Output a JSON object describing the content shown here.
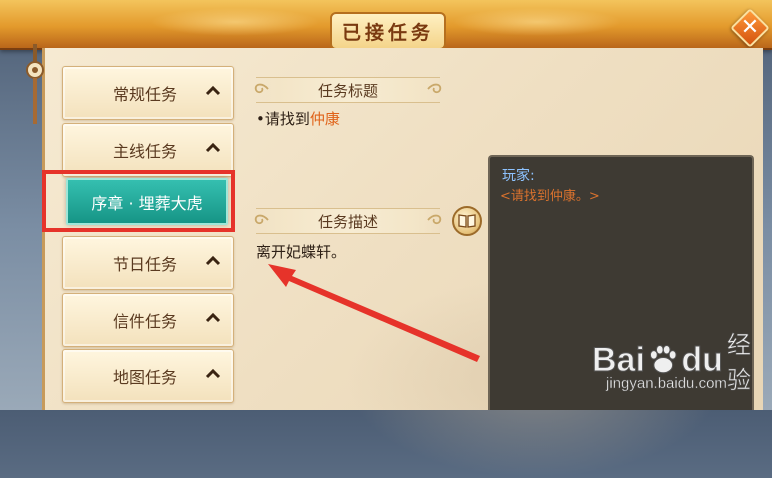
{
  "window": {
    "title": "已接任务",
    "close_glyph": "✕"
  },
  "categories": [
    {
      "label": "常规任务"
    },
    {
      "label": "主线任务"
    },
    {
      "label": "节日任务"
    },
    {
      "label": "信件任务"
    },
    {
      "label": "地图任务"
    }
  ],
  "active_subtask": {
    "label": "序章 · 埋葬大虎"
  },
  "detail": {
    "title_header": "任务标题",
    "objective_bullet": "•",
    "objective_prefix": "请找到",
    "objective_target": "仲康",
    "description_header": "任务描述",
    "description_text": "离开妃蝶轩。"
  },
  "dialog": {
    "speaker": "玩家:",
    "text": "<请找到仲康。>"
  },
  "watermark": {
    "bai": "Bai",
    "du": "du",
    "jingyan": "经验",
    "url": "jingyan.baidu.com"
  },
  "colors": {
    "highlight_text": "#e0631a",
    "subtask_bg": "#169586",
    "annotation_red": "#e6332a",
    "dialog_speaker": "#8ec3ff",
    "dialog_text": "#d9722e"
  },
  "icons": {
    "chevron": "chevron-up-icon",
    "book": "book-icon",
    "close": "close-icon",
    "watermark_logo": "baidu-paw-icon"
  }
}
